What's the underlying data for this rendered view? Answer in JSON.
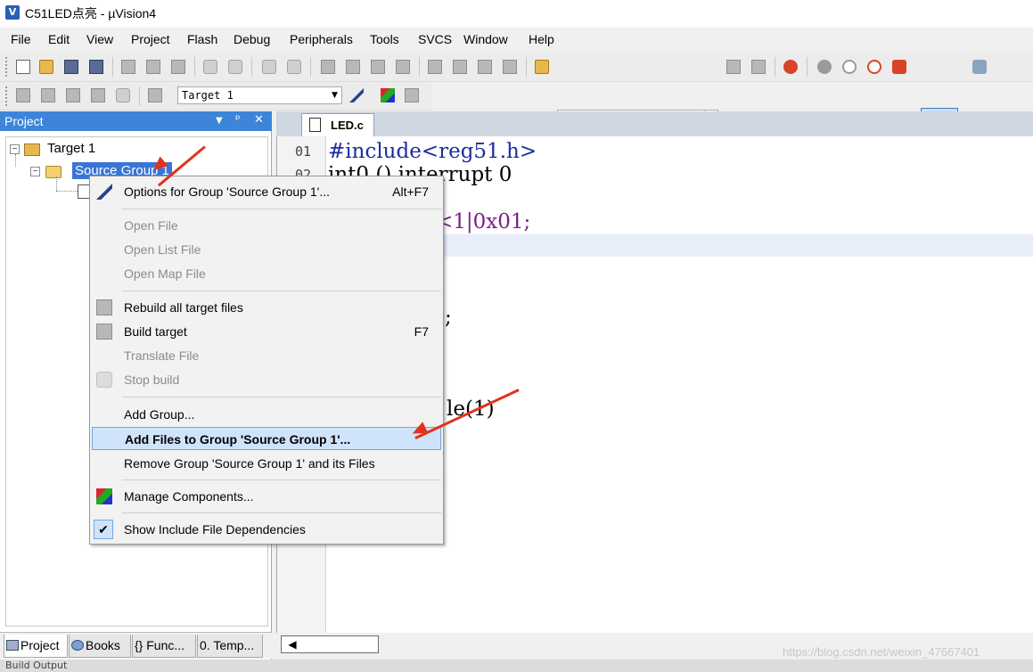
{
  "window": {
    "title": "C51LED点亮  - µVision4",
    "app_icon": "V"
  },
  "menubar": [
    "File",
    "Edit",
    "View",
    "Project",
    "Flash",
    "Debug",
    "Peripherals",
    "Tools",
    "SVCS",
    "Window",
    "Help"
  ],
  "toolbar2": {
    "target_select": "Target 1"
  },
  "project_panel": {
    "title": "Project",
    "header_controls": {
      "dropdown": "▼",
      "pin": "ᵖ",
      "close": "✕"
    },
    "tree": {
      "target": "Target 1",
      "group": "Source Group 1",
      "expand_symbol": "⊟"
    },
    "tabs": [
      "Project",
      "Books",
      "{} Func...",
      "0. Temp..."
    ]
  },
  "editor": {
    "tab_label": "LED.c",
    "line_numbers": [
      "01",
      "02"
    ],
    "visible_code": {
      "line1": "#include<reg51.h>",
      "line2": "int0 () interrupt 0",
      "frag1": "<1|0x01;",
      "frag2": ";",
      "frag3": "le(1)"
    }
  },
  "context_menu": {
    "items": [
      {
        "label": "Options for Group 'Source Group 1'...",
        "shortcut": "Alt+F7",
        "enabled": true
      },
      {
        "label": "Open File",
        "enabled": false
      },
      {
        "label": "Open List File",
        "enabled": false
      },
      {
        "label": "Open Map File",
        "enabled": false
      },
      {
        "label": "Rebuild all target files",
        "enabled": true
      },
      {
        "label": "Build target",
        "shortcut": "F7",
        "enabled": true
      },
      {
        "label": "Translate File",
        "enabled": false
      },
      {
        "label": "Stop build",
        "enabled": false
      },
      {
        "label": "Add Group...",
        "enabled": true
      },
      {
        "label": "Add Files to Group 'Source Group 1'...",
        "enabled": true,
        "highlighted": true
      },
      {
        "label": "Remove Group 'Source Group 1' and its Files",
        "enabled": true
      },
      {
        "label": "Manage Components...",
        "enabled": true
      },
      {
        "label": "Show Include File Dependencies",
        "enabled": true,
        "checked": true
      }
    ],
    "check_glyph": "✔"
  },
  "statusbar": {
    "text": "Build Output"
  },
  "watermark": "https://blog.csdn.net/weixin_47667401",
  "colors": {
    "panel_header": "#3c85d8",
    "selection": "#3875d7",
    "menu_highlight": "#cfe3fa",
    "annotation_arrow": "#e0331d"
  }
}
